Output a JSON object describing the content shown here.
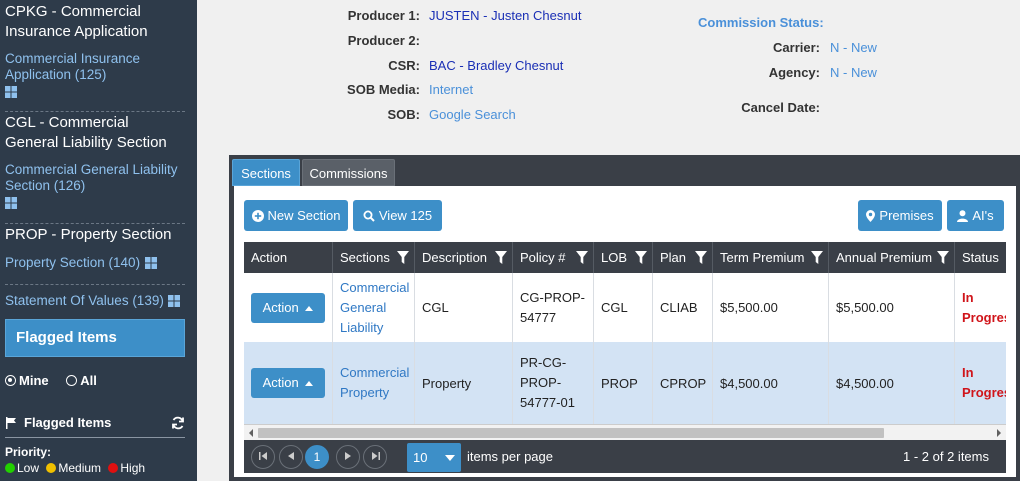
{
  "sidebar": {
    "groups": [
      {
        "title": "CPKG - Commercial Insurance Application",
        "link": "Commercial Insurance Application (125)"
      },
      {
        "title": "CGL - Commercial General Liability Section",
        "link": "Commercial General Liability Section (126)"
      },
      {
        "title": "PROP - Property Section",
        "link": "Property Section (140)"
      }
    ],
    "statement": "Statement Of Values (139)",
    "flagged_title": "Flagged Items",
    "radio_mine": "Mine",
    "radio_all": "All",
    "flagged_items_label": "Flagged Items",
    "priority_label": "Priority:",
    "priority": [
      {
        "label": "Low",
        "color": "#22d000"
      },
      {
        "label": "Medium",
        "color": "#f0c000"
      },
      {
        "label": "High",
        "color": "#e01010"
      }
    ]
  },
  "info": {
    "producer1_label": "Producer 1:",
    "producer1_value": "JUSTEN - Justen Chesnut",
    "producer2_label": "Producer 2:",
    "csr_label": "CSR:",
    "csr_value": "BAC - Bradley Chesnut",
    "sob_media_label": "SOB Media:",
    "sob_media_value": "Internet",
    "sob_label": "SOB:",
    "sob_value": "Google Search",
    "commission_status": "Commission Status:",
    "carrier_label": "Carrier:",
    "carrier_value": "N - New",
    "agency_label": "Agency:",
    "agency_value": "N - New",
    "cancel_label": "Cancel Date:"
  },
  "tabs": {
    "sections": "Sections",
    "commissions": "Commissions"
  },
  "toolbar": {
    "new_section": "New Section",
    "view": "View 125",
    "premises": "Premises",
    "ais": "AI's"
  },
  "grid": {
    "headers": [
      "Action",
      "Sections",
      "Description",
      "Policy #",
      "LOB",
      "Plan",
      "Term Premium",
      "Annual Premium",
      "Status"
    ],
    "rows": [
      {
        "action": "Action",
        "section": "Commercial General Liability",
        "description": "CGL",
        "policy": "CG-PROP-54777",
        "lob": "CGL",
        "plan": "CLIAB",
        "term": "$5,500.00",
        "annual": "$5,500.00",
        "status": "In Progress"
      },
      {
        "action": "Action",
        "section": "Commercial Property",
        "description": "Property",
        "policy": "PR-CG-PROP-54777-01",
        "lob": "PROP",
        "plan": "CPROP",
        "term": "$4,500.00",
        "annual": "$4,500.00",
        "status": "In Progress"
      }
    ]
  },
  "pager": {
    "current_page": "1",
    "per_page": "10",
    "per_page_label": "items per page",
    "summary": "1 - 2 of 2 items"
  },
  "colors": {
    "accent": "#3d8fc8",
    "sidebar": "#2e3b4a",
    "grid_header": "#3a3f47",
    "status": "#d0141a",
    "row_alt": "#d3e3f4"
  }
}
